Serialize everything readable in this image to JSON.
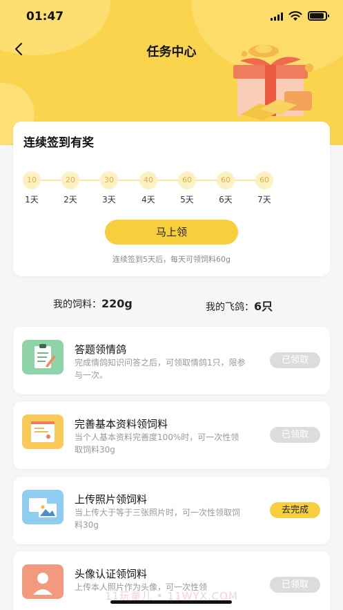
{
  "status_bar": {
    "time": "01:47"
  },
  "header": {
    "title": "任务中心"
  },
  "signin": {
    "title": "连续签到有奖",
    "days": [
      {
        "coin": "10",
        "label": "1天"
      },
      {
        "coin": "20",
        "label": "2天"
      },
      {
        "coin": "30",
        "label": "3天"
      },
      {
        "coin": "40",
        "label": "4天"
      },
      {
        "coin": "60",
        "label": "5天"
      },
      {
        "coin": "60",
        "label": "6天"
      },
      {
        "coin": "60",
        "label": "7天"
      }
    ],
    "button_label": "马上领",
    "note": "连续签到5天后，每天可领饲料60g"
  },
  "stats": {
    "feed_label": "我的饲料：",
    "feed_value": "220g",
    "pigeon_label": "我的飞鸽：",
    "pigeon_value": "6只"
  },
  "tasks": [
    {
      "icon": "clipboard-icon",
      "title": "答题领情鸽",
      "desc": "完成情鸽知识问答之后，可领取情鸽1只，限参与一次。",
      "button": "已领取",
      "status": "done",
      "color": "#8fd3a8"
    },
    {
      "icon": "profile-card-icon",
      "title": "完善基本资料领饲料",
      "desc": "当个人基本资料完善度100%时，可一次性领取饲料30g",
      "button": "已领取",
      "status": "done",
      "color": "#f9c95a"
    },
    {
      "icon": "photos-icon",
      "title": "上传照片领饲料",
      "desc": "当上传大于等于三张照片时，可一次性领取饲料30g",
      "button": "去完成",
      "status": "todo",
      "color": "#8fcdf0"
    },
    {
      "icon": "avatar-icon",
      "title": "头像认证领饲料",
      "desc": "上传本人照片作为头像，可一次性领",
      "button": "已领取",
      "status": "done",
      "color": "#f39a7e"
    }
  ],
  "watermark": "11玩童儿 • 11WYX.COM"
}
